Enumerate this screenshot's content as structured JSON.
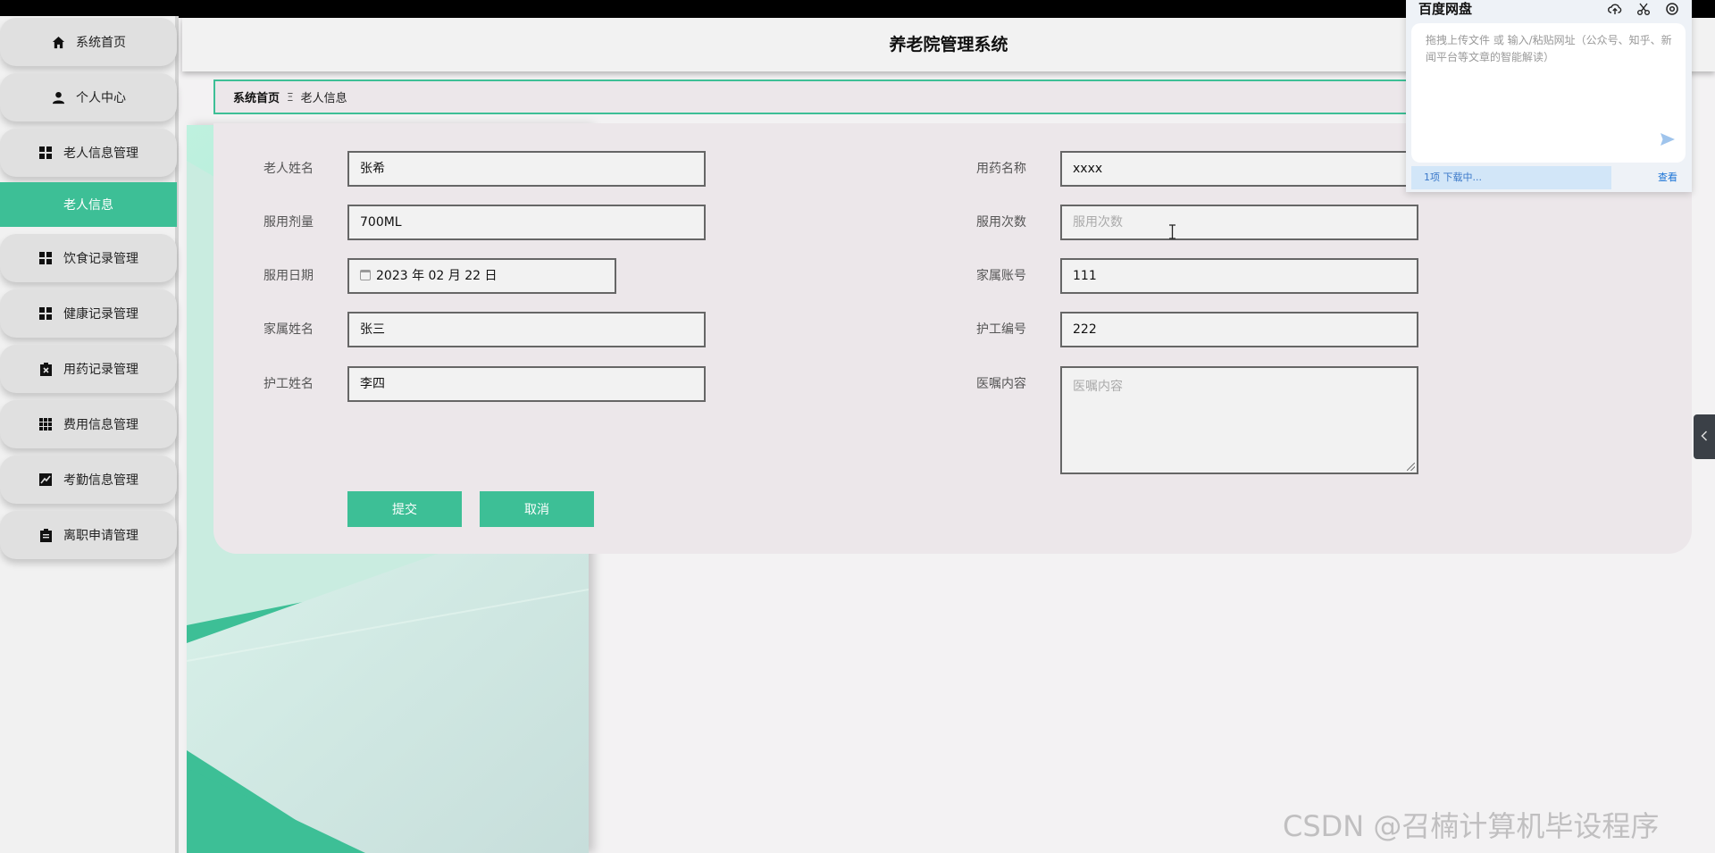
{
  "app": {
    "title": "养老院管理系统"
  },
  "sidebar": {
    "items": [
      {
        "label": "系统首页",
        "icon": "home-icon"
      },
      {
        "label": "个人中心",
        "icon": "user-icon"
      },
      {
        "label": "老人信息管理",
        "icon": "grid-icon"
      },
      {
        "label": "老人信息",
        "icon": "",
        "active": true
      },
      {
        "label": "饮食记录管理",
        "icon": "grid-icon"
      },
      {
        "label": "健康记录管理",
        "icon": "grid-icon"
      },
      {
        "label": "用药记录管理",
        "icon": "clipboard-x-icon"
      },
      {
        "label": "费用信息管理",
        "icon": "grid-9-icon"
      },
      {
        "label": "考勤信息管理",
        "icon": "chart-icon"
      },
      {
        "label": "离职申请管理",
        "icon": "clipboard-icon"
      }
    ],
    "accent_color": "#3dbf96"
  },
  "breadcrumb": {
    "home": "系统首页",
    "separator": "Ξ",
    "current": "老人信息"
  },
  "form": {
    "fields": {
      "elder_name": {
        "label": "老人姓名",
        "value": "张希"
      },
      "dosage": {
        "label": "服用剂量",
        "value": "700ML"
      },
      "date": {
        "label": "服用日期",
        "value": "2023 年 02 月 22 日"
      },
      "family_name": {
        "label": "家属姓名",
        "value": "张三"
      },
      "caregiver_name": {
        "label": "护工姓名",
        "value": "李四"
      },
      "drug_name": {
        "label": "用药名称",
        "value": "xxxx"
      },
      "frequency": {
        "label": "服用次数",
        "value": "",
        "placeholder": "服用次数"
      },
      "family_account": {
        "label": "家属账号",
        "value": "111"
      },
      "caregiver_id": {
        "label": "护工编号",
        "value": "222"
      },
      "doctor_advice": {
        "label": "医嘱内容",
        "value": "",
        "placeholder": "医嘱内容"
      }
    },
    "submit_label": "提交",
    "cancel_label": "取消"
  },
  "netdisk": {
    "title": "百度网盘",
    "hint": "拖拽上传文件 或 输入/粘贴网址（公众号、知乎、新闻平台等文章的智能解读）",
    "status": "1项 下载中...",
    "link": "查看"
  },
  "watermark": "CSDN @召楠计算机毕设程序"
}
